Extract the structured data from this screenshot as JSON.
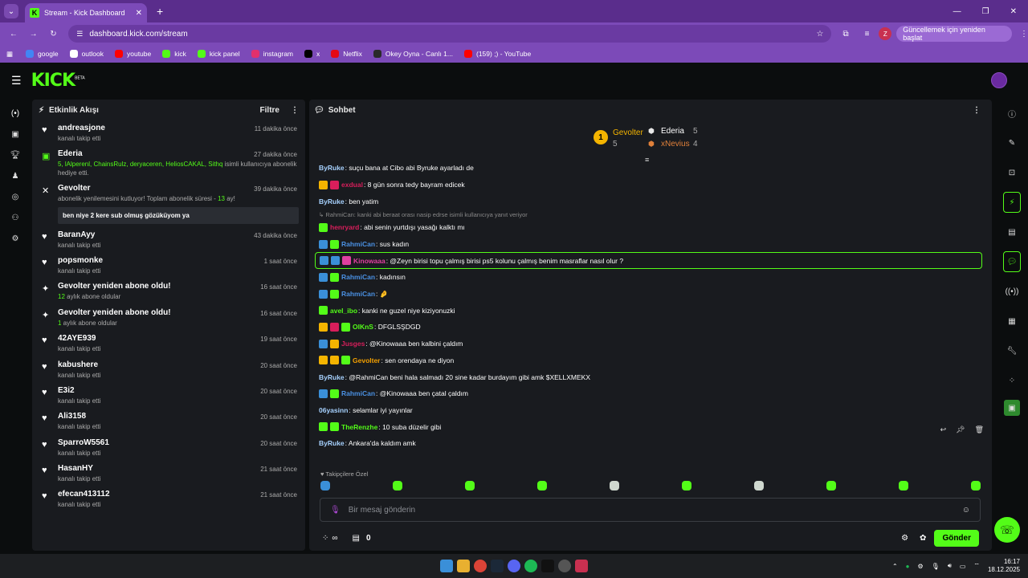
{
  "browser": {
    "tab_title": "Stream - Kick Dashboard",
    "url": "dashboard.kick.com/stream",
    "update_label": "Güncellemek için yeniden başlat",
    "profile_initial": "Z",
    "bookmarks": [
      {
        "label": "google",
        "color": "#4285f4"
      },
      {
        "label": "outlook",
        "color": "#ffffff"
      },
      {
        "label": "youtube",
        "color": "#ff0000"
      },
      {
        "label": "kick",
        "color": "#53fc18"
      },
      {
        "label": "kick panel",
        "color": "#53fc18"
      },
      {
        "label": "instagram",
        "color": "#e1306c"
      },
      {
        "label": "x",
        "color": "#000000"
      },
      {
        "label": "Netflix",
        "color": "#e50914"
      },
      {
        "label": "Okey Oyna - Canlı 1...",
        "color": "#2a2a2a"
      },
      {
        "label": "(159) ;) - YouTube",
        "color": "#ff0000"
      }
    ]
  },
  "app": {
    "logo": "KICK",
    "logo_badge": "BETA"
  },
  "feed": {
    "title": "Etkinlik Akışı",
    "filter_label": "Filtre",
    "events": [
      {
        "icon": "heart",
        "name": "andreasjone",
        "sub": "kanalı takip etti",
        "time": "11 dakika önce"
      },
      {
        "icon": "gift",
        "name": "Ederia",
        "sub_green": "5, lAlperenl, ChainsRulz, deryaceren, HeliosCAKAL, Sithq",
        "sub": " isimli kullanıcıya abonelik hediye etti.",
        "time": "27 dakika önce"
      },
      {
        "icon": "sub",
        "name": "Gevolter",
        "sub": "abonelik yenilemesini kutluyor! Toplam abonelik süresi - ",
        "sub_green": "13",
        "sub_tail": " ay!",
        "quote": "ben niye 2 kere sub olmuş gözüküyom ya",
        "time": "39 dakika önce"
      },
      {
        "icon": "heart",
        "name": "BaranAyy",
        "sub": "kanalı takip etti",
        "time": "43 dakika önce"
      },
      {
        "icon": "heart",
        "name": "popsmonke",
        "sub": "kanalı takip etti",
        "time": "1 saat önce"
      },
      {
        "icon": "star",
        "name": "Gevolter yeniden abone oldu!",
        "sub_green": "12",
        "sub": " aylık abone oldular",
        "time": "16 saat önce"
      },
      {
        "icon": "star",
        "name": "Gevolter yeniden abone oldu!",
        "sub_green": "1",
        "sub": " aylık abone oldular",
        "time": "16 saat önce"
      },
      {
        "icon": "heart",
        "name": "42AYE939",
        "sub": "kanalı takip etti",
        "time": "19 saat önce"
      },
      {
        "icon": "heart",
        "name": "kabushere",
        "sub": "kanalı takip etti",
        "time": "20 saat önce"
      },
      {
        "icon": "heart",
        "name": "E3i2",
        "sub": "kanalı takip etti",
        "time": "20 saat önce"
      },
      {
        "icon": "heart",
        "name": "Ali3158",
        "sub": "kanalı takip etti",
        "time": "20 saat önce"
      },
      {
        "icon": "heart",
        "name": "SparroW5561",
        "sub": "kanalı takip etti",
        "time": "20 saat önce"
      },
      {
        "icon": "heart",
        "name": "HasanHY",
        "sub": "kanalı takip etti",
        "time": "21 saat önce"
      },
      {
        "icon": "heart",
        "name": "efecan413112",
        "sub": "kanalı takip etti",
        "time": "21 saat önce"
      }
    ]
  },
  "chat": {
    "title": "Sohbet",
    "leaderboard": {
      "first_name": "Gevolter",
      "first_count": "5",
      "second_name": "Ederia",
      "second_count": "5",
      "third_name": "xNevius",
      "third_count": "4"
    },
    "messages": [
      {
        "user": "ByRuke",
        "color": "#a7d2ff",
        "text": ": suçu bana at Cibo abi Byruke ayarladı de",
        "badges": []
      },
      {
        "user": "exdual",
        "color": "#d81e5b",
        "text": ": 8 gün sonra tedy bayram edicek",
        "badges": [
          "#f4b400",
          "#d81e5b"
        ]
      },
      {
        "user": "ByRuke",
        "color": "#a7d2ff",
        "text": ": ben yatim",
        "badges": []
      },
      {
        "reply": "RahmiCan: kanki abi beraat orası nasip edrse isimli kullanıcıya yanıt veriyor"
      },
      {
        "user": "henryard",
        "color": "#d81e5b",
        "text": ": abi senin yurtdışı yasağı kalktı mı",
        "badges": [
          "#53fc18"
        ]
      },
      {
        "user": "RahmiCan",
        "color": "#4a90e2",
        "text": ": sus kadın",
        "badges": [
          "#3a8fd8",
          "#53fc18"
        ]
      },
      {
        "user": "Kinowaaa",
        "color": "#e040a0",
        "text": ": @Zeyn birisi topu çalmış birisi ps5 kolunu çalmış benim masraflar nasıl olur ?",
        "badges": [
          "#3a8fd8",
          "#3a8fd8",
          "#e040a0"
        ],
        "highlight": true
      },
      {
        "user": "RahmiCan",
        "color": "#4a90e2",
        "text": ": kadınsın",
        "badges": [
          "#3a8fd8",
          "#53fc18"
        ]
      },
      {
        "user": "RahmiCan",
        "color": "#4a90e2",
        "text": ": 🤌",
        "badges": [
          "#3a8fd8",
          "#53fc18"
        ]
      },
      {
        "user": "avel_ibo",
        "color": "#53fc18",
        "text": ": kanki ne guzel niye kiziyonuzki",
        "badges": [
          "#53fc18"
        ]
      },
      {
        "user": "OlKnS",
        "color": "#53fc18",
        "text": ": DFGLSŞDGD",
        "badges": [
          "#f4b400",
          "#d81e5b",
          "#53fc18"
        ]
      },
      {
        "user": "Jusges",
        "color": "#d81e5b",
        "text": ": @Kinowaaa ben kalbini çaldım",
        "badges": [
          "#3a8fd8",
          "#f4b400"
        ]
      },
      {
        "user": "Gevolter",
        "color": "#f4a000",
        "text": ": sen orendaya ne diyon",
        "badges": [
          "#f4b400",
          "#f4b400",
          "#53fc18"
        ]
      },
      {
        "user": "ByRuke",
        "color": "#a7d2ff",
        "text": ": @RahmiCan beni hala salmadı 20 sine kadar burdayım gibi amk $XELLXMEKX",
        "badges": []
      },
      {
        "user": "RahmiCan",
        "color": "#4a90e2",
        "text": ": @Kinowaaa ben çatal çaldım",
        "badges": [
          "#3a8fd8",
          "#53fc18"
        ]
      },
      {
        "user": "06yasinn",
        "color": "#a7d2ff",
        "text": ": selamlar iyi yayınlar",
        "badges": []
      },
      {
        "user": "TheRenzhe",
        "color": "#53fc18",
        "text": ": 10 suba düzelir gibi",
        "badges": [
          "#53fc18",
          "#53fc18"
        ]
      },
      {
        "user": "ByRuke",
        "color": "#a7d2ff",
        "text": ": Ankara'da kaldım amk",
        "badges": []
      }
    ],
    "follow_only": "Takipçilere Özel",
    "input_placeholder": "Bir mesaj gönderin",
    "infinity": "∞",
    "count": "0",
    "send_label": "Gönder"
  },
  "taskbar": {
    "time": "16:17",
    "date": "18.12.2025"
  }
}
